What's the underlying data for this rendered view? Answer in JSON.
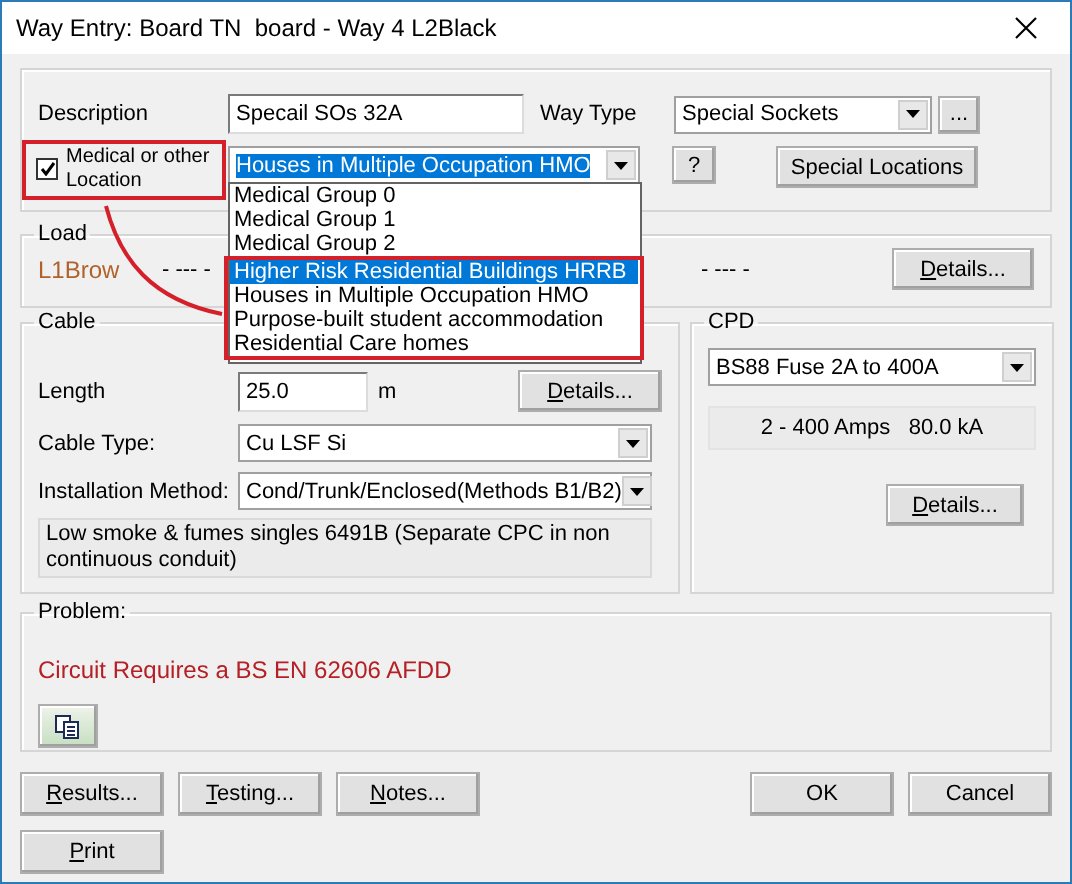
{
  "window": {
    "title": "Way Entry: Board TN  board - Way 4 L2Black"
  },
  "general": {
    "description": {
      "label": "Description",
      "value": "Specail SOs 32A"
    },
    "way_type": {
      "label": "Way Type",
      "value": "Special Sockets"
    },
    "more_button": "...",
    "location_checkbox": {
      "label": "Medical or other Location",
      "checked": true
    },
    "location_combo": {
      "value": "Houses in Multiple Occupation HMO",
      "expanded": true
    },
    "help_button": "?",
    "special_locations_button": "Special Locations"
  },
  "location_options": [
    {
      "label": "Medical Group 0",
      "selected": false
    },
    {
      "label": "Medical Group 1",
      "selected": false
    },
    {
      "label": "Medical Group 2",
      "selected": false
    },
    {
      "label": "Higher Risk Residential Buildings HRRB",
      "selected": true
    },
    {
      "label": "Houses in Multiple Occupation HMO",
      "selected": false
    },
    {
      "label": "Purpose-built student accommodation",
      "selected": false
    },
    {
      "label": "Residential Care homes",
      "selected": false
    }
  ],
  "load": {
    "title": "Load",
    "phase": "L1Brow",
    "reading_1": "- --- -",
    "reading_2": "- --- -",
    "details_button": {
      "label": "Details...",
      "mnemonic": true
    }
  },
  "cable": {
    "title": "Cable",
    "length": {
      "label": "Length",
      "value": "25.0",
      "unit": "m"
    },
    "details_button": {
      "label": "Details...",
      "mnemonic": true
    },
    "cable_type": {
      "label": "Cable Type:",
      "value": "Cu LSF  Si"
    },
    "installation_method": {
      "label": "Installation Method:",
      "value": "Cond/Trunk/Enclosed(Methods B1/B2)"
    },
    "note": "Low smoke & fumes singles 6491B (Separate CPC in non continuous conduit)"
  },
  "cpd": {
    "title": "CPD",
    "device": "BS88 Fuse 2A to 400A",
    "rating": "2 - 400 Amps   80.0 kA",
    "details_button": {
      "label": "Details...",
      "mnemonic": true
    }
  },
  "problem": {
    "title": "Problem:",
    "message": "Circuit Requires a BS EN 62606 AFDD"
  },
  "buttons": [
    {
      "label": "Results...",
      "mnemonic": true,
      "kind": "left"
    },
    {
      "label": "Testing...",
      "mnemonic": true,
      "kind": "left"
    },
    {
      "label": "Notes...",
      "mnemonic": true,
      "kind": "left"
    },
    {
      "label": "OK",
      "mnemonic": false,
      "kind": "right"
    },
    {
      "label": "Cancel",
      "mnemonic": false,
      "kind": "right"
    },
    {
      "label": "Print",
      "mnemonic": true,
      "kind": "second_row"
    }
  ]
}
